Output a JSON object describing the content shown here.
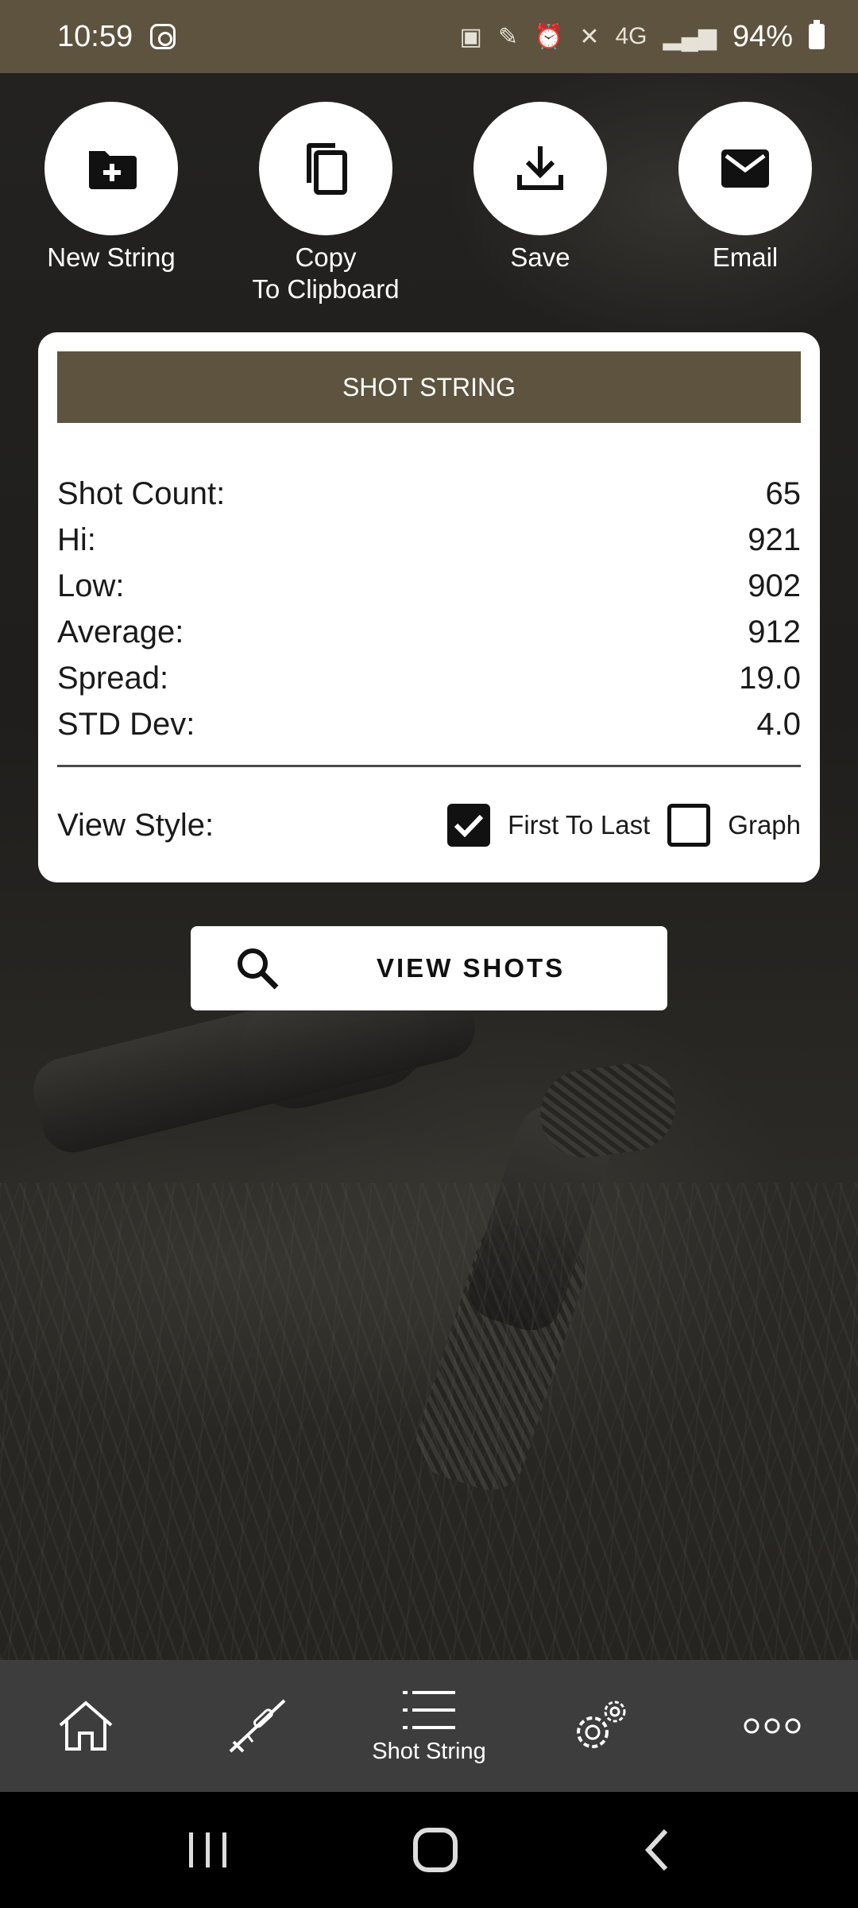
{
  "status_bar": {
    "time": "10:59",
    "battery": "94%",
    "network": "4G"
  },
  "actions": [
    {
      "label": "New String",
      "icon": "folder-plus-icon"
    },
    {
      "label": "Copy\nTo Clipboard",
      "icon": "copy-icon"
    },
    {
      "label": "Save",
      "icon": "download-icon"
    },
    {
      "label": "Email",
      "icon": "email-icon"
    }
  ],
  "card": {
    "header": "SHOT STRING",
    "stats": [
      {
        "label": "Shot Count:",
        "value": "65"
      },
      {
        "label": "Hi:",
        "value": "921"
      },
      {
        "label": "Low:",
        "value": "902"
      },
      {
        "label": "Average:",
        "value": "912"
      },
      {
        "label": "Spread:",
        "value": "19.0"
      },
      {
        "label": "STD Dev:",
        "value": "4.0"
      }
    ],
    "view_style": {
      "label": "View Style:",
      "options": [
        {
          "label": "First To Last",
          "checked": true
        },
        {
          "label": "Graph",
          "checked": false
        }
      ]
    }
  },
  "view_shots_button": "VIEW SHOTS",
  "bottom_nav": [
    {
      "icon": "home-icon",
      "label": ""
    },
    {
      "icon": "rifle-icon",
      "label": ""
    },
    {
      "icon": "list-icon",
      "label": "Shot String"
    },
    {
      "icon": "gear-icon",
      "label": ""
    },
    {
      "icon": "more-icon",
      "label": ""
    }
  ],
  "colors": {
    "accent": "#5d533e",
    "nav_bg": "#3d3d3d",
    "card_bg": "#ffffff"
  }
}
